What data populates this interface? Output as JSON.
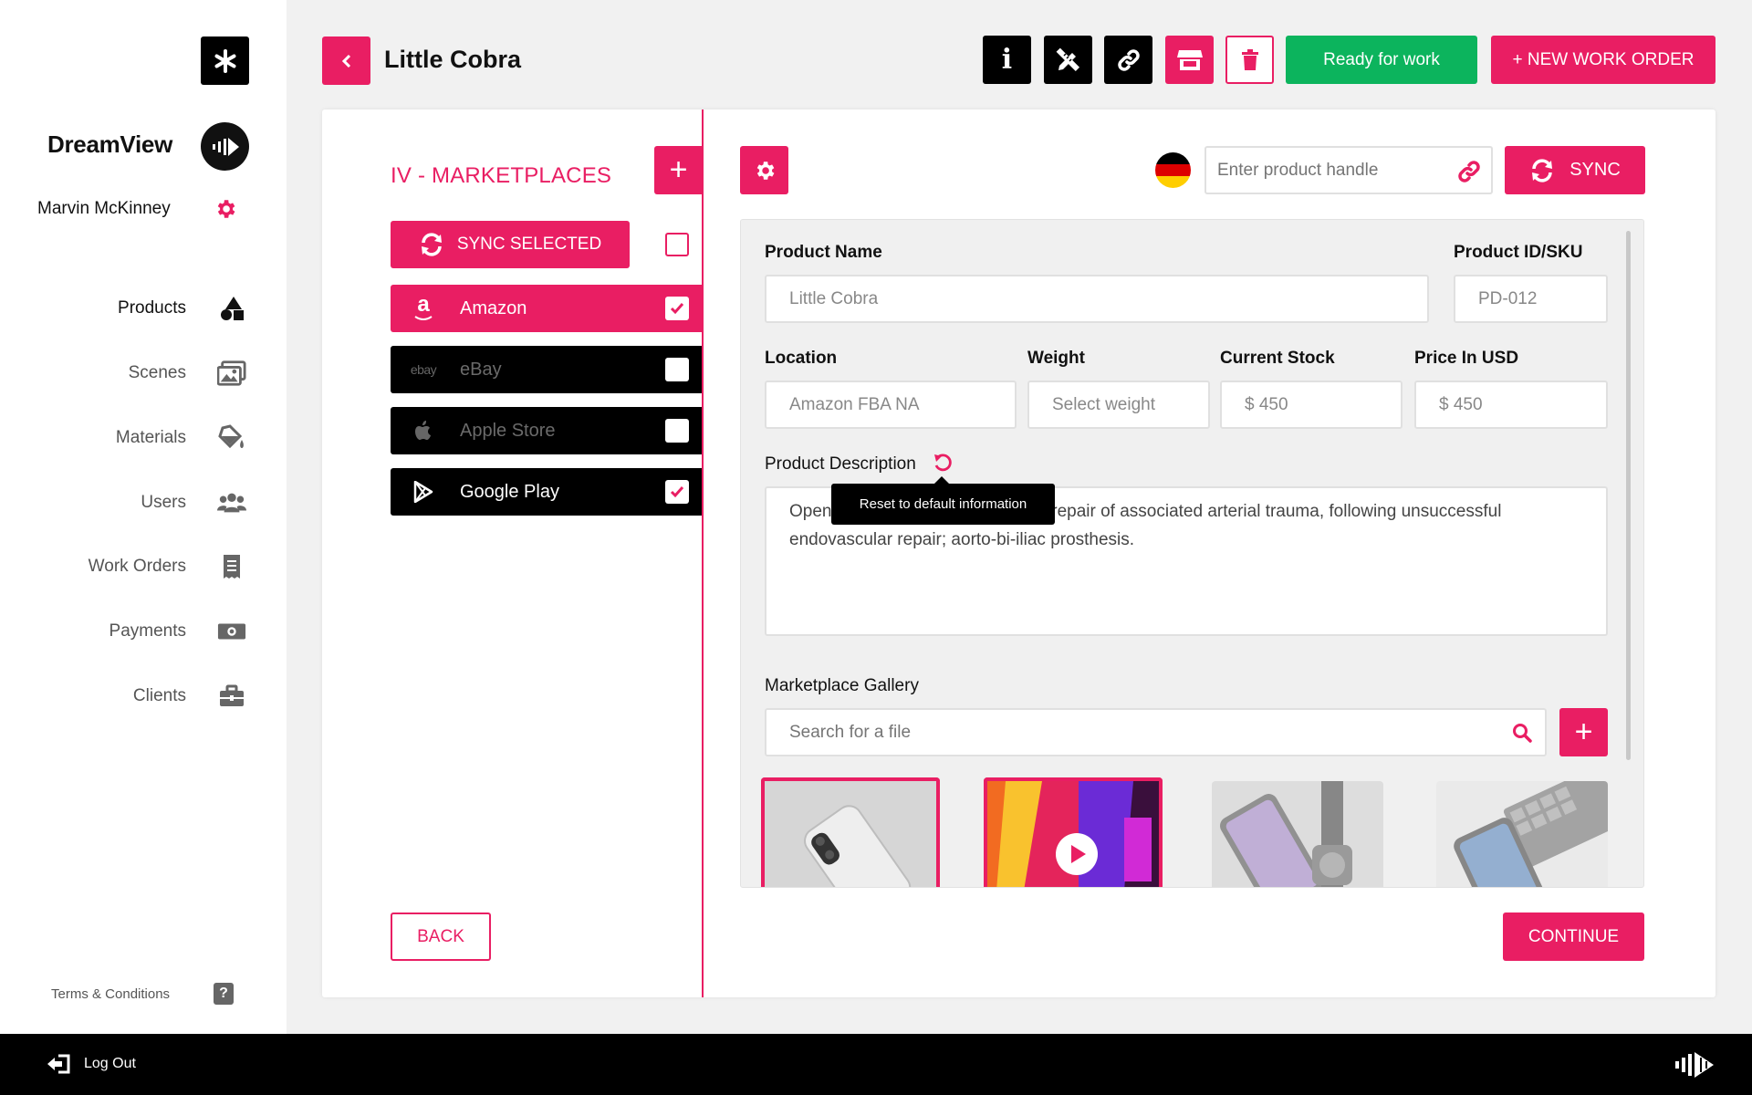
{
  "app": {
    "brand": "DreamView",
    "user": "Marvin McKinney"
  },
  "nav": {
    "items": [
      {
        "label": "Products",
        "icon": "shapes-icon"
      },
      {
        "label": "Scenes",
        "icon": "images-icon"
      },
      {
        "label": "Materials",
        "icon": "paint-bucket-icon"
      },
      {
        "label": "Users",
        "icon": "users-icon"
      },
      {
        "label": "Work Orders",
        "icon": "receipt-icon"
      },
      {
        "label": "Payments",
        "icon": "money-icon"
      },
      {
        "label": "Clients",
        "icon": "briefcase-icon"
      }
    ],
    "active": "Products",
    "terms": "Terms & Conditions",
    "help_icon_text": "?"
  },
  "footer": {
    "logout": "Log Out"
  },
  "header": {
    "title": "Little Cobra",
    "ready_label": "Ready for work",
    "new_order_label": "+ NEW WORK ORDER",
    "info_icon_text": "i"
  },
  "marketplaces": {
    "title": "IV - MARKETPLACES",
    "add_label": "+",
    "sync_selected": "SYNC SELECTED",
    "items": [
      {
        "label": "Amazon",
        "checked": true,
        "active": true
      },
      {
        "label": "eBay",
        "checked": false,
        "active": false
      },
      {
        "label": "Apple Store",
        "checked": false,
        "active": false
      },
      {
        "label": "Google Play",
        "checked": true,
        "active": false
      }
    ],
    "ebay_logo_text": "ebay",
    "amazon_logo_text": "a",
    "back_label": "BACK"
  },
  "product": {
    "handle_placeholder": "Enter product handle",
    "sync_label": "SYNC",
    "name_label": "Product Name",
    "name_value": "Little Cobra",
    "sku_label": "Product ID/SKU",
    "sku_value": "PD-012",
    "location_label": "Location",
    "location_value": "Amazon FBA NA",
    "weight_label": "Weight",
    "weight_value": "Select weight",
    "stock_label": "Current Stock",
    "stock_value": "$ 450",
    "price_label": "Price In USD",
    "price_value": "$ 450",
    "description_label": "Product Description",
    "description_value": "Open neurysm or dissection, plus repair of associated arterial trauma, following unsuccessful endovascular repair; aorto-bi-iliac prosthesis.",
    "tooltip": "Reset to default information",
    "gallery_label": "Marketplace Gallery",
    "gallery_search_placeholder": "Search for a file",
    "gallery_add_label": "+",
    "continue_label": "CONTINUE"
  },
  "colors": {
    "accent": "#e91e63",
    "ready": "#0cb45d",
    "dark": "#000000"
  }
}
